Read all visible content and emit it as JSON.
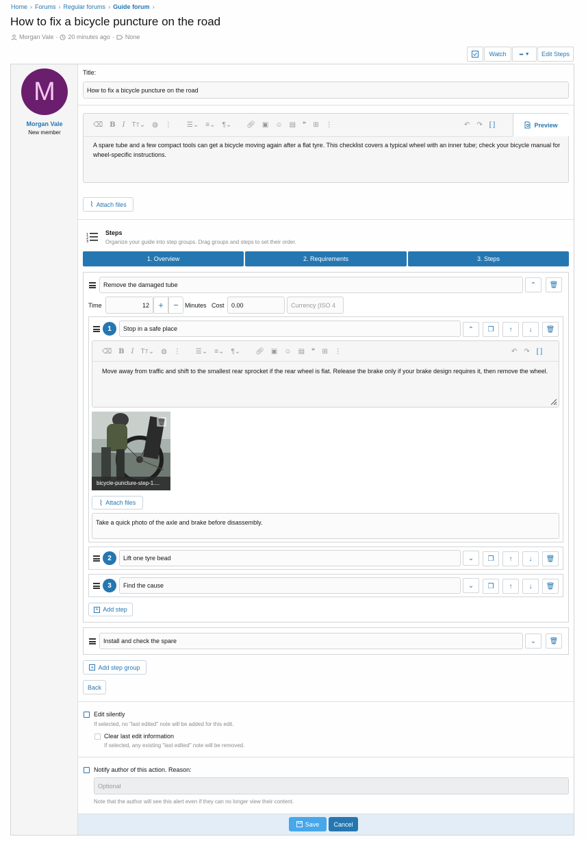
{
  "breadcrumb": [
    "Home",
    "Forums",
    "Regular forums",
    "Guide forum"
  ],
  "page_title": "How to fix a bicycle puncture on the road",
  "meta": {
    "author": "Morgan Vale",
    "time": "20 minutes ago",
    "tags": "None"
  },
  "toolbar": {
    "watch": "Watch",
    "more": "•••",
    "edit_steps": "Edit Steps"
  },
  "user": {
    "initial": "M",
    "name": "Morgan Vale",
    "title": "New member",
    "avatar_color": "#6b1e6d"
  },
  "form": {
    "title_label": "Title:",
    "title_value": "How to fix a bicycle puncture on the road",
    "preview_label": "Preview",
    "intro_text": "A spare tube and a few compact tools can get a bicycle moving again after a flat tyre. This checklist covers a typical wheel with an inner tube; check your bicycle manual for wheel-specific instructions.",
    "attach_files": "Attach files"
  },
  "steps_section": {
    "title": "Steps",
    "subtitle": "Organize your guide into step groups. Drag groups and steps to set their order.",
    "tabs": [
      "1. Overview",
      "2. Requirements",
      "3. Steps"
    ]
  },
  "group1": {
    "title": "Remove the damaged tube",
    "time_label": "Time",
    "time_value": "12",
    "minutes_label": "Minutes",
    "cost_label": "Cost",
    "cost_value": "0.00",
    "currency_placeholder": "Currency (ISO 4",
    "steps": [
      {
        "number": "1",
        "title": "Stop in a safe place",
        "body": "Move away from traffic and shift to the smallest rear sprocket if the rear wheel is flat. Release the brake only if your brake design requires it, then remove the wheel.",
        "attachment_name": "bicycle-puncture-step-1....",
        "attach_files": "Attach files",
        "note": "Take a quick photo of the axle and brake before disassembly."
      },
      {
        "number": "2",
        "title": "Lift one tyre bead"
      },
      {
        "number": "3",
        "title": "Find the cause"
      }
    ],
    "add_step": "Add step"
  },
  "group2": {
    "title": "Install and check the spare"
  },
  "add_step_group": "Add step group",
  "back": "Back",
  "options": {
    "edit_silently": "Edit silently",
    "edit_silently_hint": "If selected, no \"last edited\" note will be added for this edit.",
    "clear_last_edit": "Clear last edit information",
    "clear_last_edit_hint": "If selected, any existing \"last edited\" note will be removed.",
    "notify_author": "Notify author of this action. Reason:",
    "reason_placeholder": "Optional",
    "notify_hint": "Note that the author will see this alert even if they can no longer view their content."
  },
  "actions": {
    "save": "Save",
    "cancel": "Cancel"
  }
}
